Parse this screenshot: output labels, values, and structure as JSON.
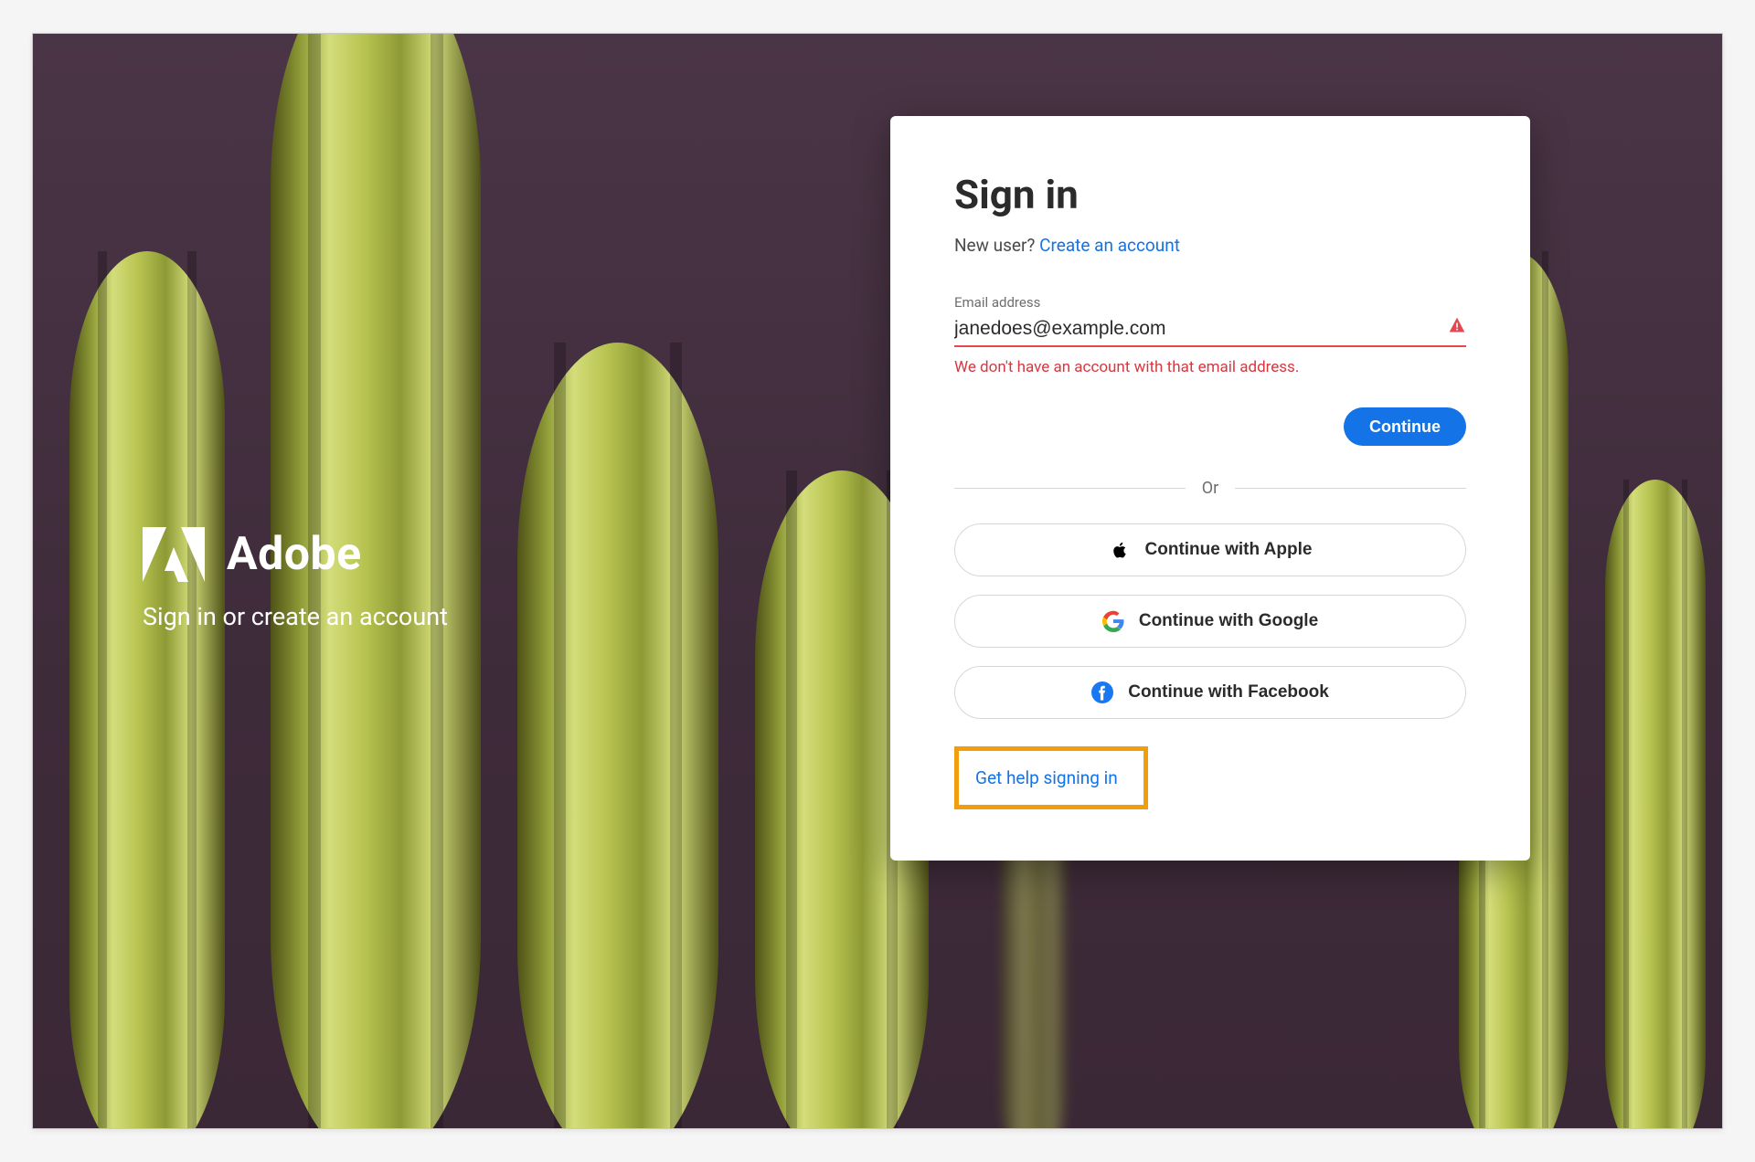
{
  "brand": {
    "name": "Adobe",
    "tagline": "Sign in or create an account"
  },
  "card": {
    "title": "Sign in",
    "new_user_text": "New user?",
    "create_account": "Create an account",
    "email_label": "Email address",
    "email_value": "janedoes@example.com",
    "error_message": "We don't have an account with that email address.",
    "continue_label": "Continue",
    "divider_label": "Or",
    "social": {
      "apple": "Continue with Apple",
      "google": "Continue with Google",
      "facebook": "Continue with Facebook"
    },
    "help_link": "Get help signing in"
  },
  "colors": {
    "accent": "#1473e6",
    "error": "#d7373f",
    "highlight_box": "#f29d0c"
  }
}
